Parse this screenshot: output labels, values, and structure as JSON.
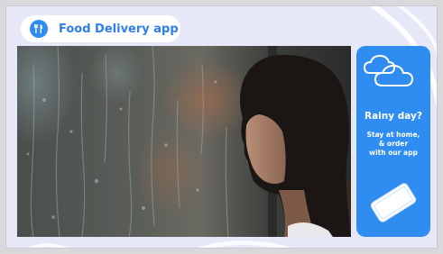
{
  "app": {
    "title": "Food Delivery app",
    "icon": "cutlery-icon",
    "accent_color": "#2f8cf0"
  },
  "promo": {
    "headline": "Rainy day?",
    "body_lines": [
      "Stay at home,",
      "& order",
      "with our app"
    ],
    "top_icon": "clouds-icon",
    "bottom_icon": "smartphone-icon",
    "background_color": "#2f8cf0"
  },
  "media": {
    "icon": "video-frame"
  }
}
